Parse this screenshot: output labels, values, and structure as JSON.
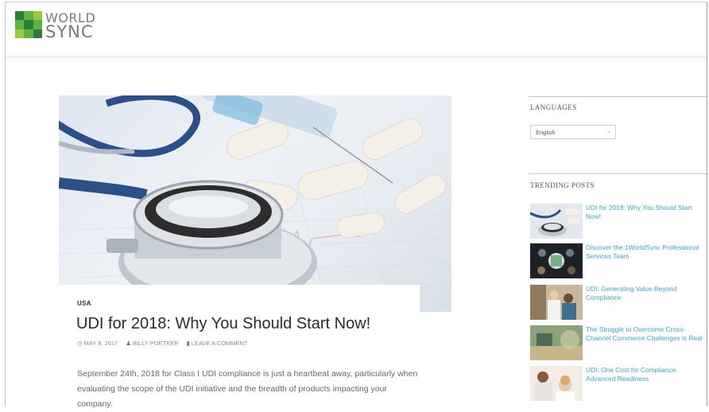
{
  "brand": {
    "logo_line1": "WORLD",
    "logo_line2": "SYNC",
    "colors": {
      "dark_green": "#2f7d3a",
      "green": "#5fb346",
      "lime": "#9bcb3b",
      "grey": "#7a7a7a"
    }
  },
  "article": {
    "category": "USA",
    "title": "UDI for 2018: Why You Should Start Now!",
    "date": "MAY 8, 2017",
    "author": "BILLY POETKER",
    "comment_link": "LEAVE A COMMENT",
    "excerpt": "September 24th, 2018 for Class I UDI compliance is just a heartbeat away, particularly when evaluating the scope of the UDI initiative and the breadth of products impacting your company.",
    "icons": {
      "date": "clock-icon",
      "author": "user-icon",
      "comment": "comment-icon"
    }
  },
  "sidebar": {
    "languages_heading": "LANGUAGES",
    "language_selected": "English",
    "trending_heading": "TRENDING POSTS",
    "link_color": "#3fa4cc",
    "posts": [
      {
        "title": "UDI for 2018: Why You Should Start Now!"
      },
      {
        "title": "Discover the 1WorldSync Professional Services Team"
      },
      {
        "title": "UDI: Generating Value Beyond Compliance"
      },
      {
        "title": "The Struggle to Overcome Cross-Channel Commerce Challenges is Real"
      },
      {
        "title": "UDI: One Cost for Compliance. Advanced Readiness"
      }
    ]
  }
}
